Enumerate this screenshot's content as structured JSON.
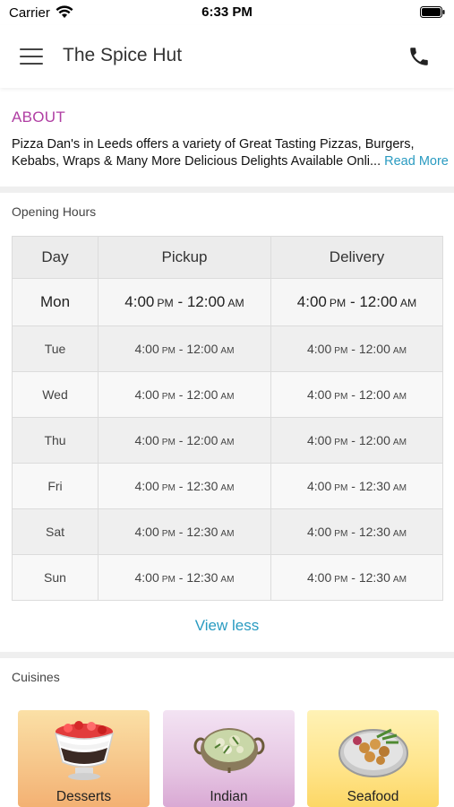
{
  "status_bar": {
    "carrier": "Carrier",
    "time": "6:33 PM"
  },
  "header": {
    "title": "The Spice Hut"
  },
  "about": {
    "heading": "ABOUT",
    "text_line1": "Pizza Dan's in Leeds offers a variety of Great Tasting Pizzas, Burgers,",
    "text_line2": "Kebabs, Wraps & Many More Delicious Delights Available Onli...",
    "read_more": "Read More"
  },
  "opening_hours": {
    "heading": "Opening Hours",
    "columns": [
      "Day",
      "Pickup",
      "Delivery"
    ],
    "rows": [
      {
        "day": "Mon",
        "pickup_from": "4:00",
        "pickup_from_ampm": "PM",
        "pickup_to": "12:00",
        "pickup_to_ampm": "AM",
        "delivery_from": "4:00",
        "delivery_from_ampm": "PM",
        "delivery_to": "12:00",
        "delivery_to_ampm": "AM"
      },
      {
        "day": "Tue",
        "pickup_from": "4:00",
        "pickup_from_ampm": "PM",
        "pickup_to": "12:00",
        "pickup_to_ampm": "AM",
        "delivery_from": "4:00",
        "delivery_from_ampm": "PM",
        "delivery_to": "12:00",
        "delivery_to_ampm": "AM"
      },
      {
        "day": "Wed",
        "pickup_from": "4:00",
        "pickup_from_ampm": "PM",
        "pickup_to": "12:00",
        "pickup_to_ampm": "AM",
        "delivery_from": "4:00",
        "delivery_from_ampm": "PM",
        "delivery_to": "12:00",
        "delivery_to_ampm": "AM"
      },
      {
        "day": "Thu",
        "pickup_from": "4:00",
        "pickup_from_ampm": "PM",
        "pickup_to": "12:00",
        "pickup_to_ampm": "AM",
        "delivery_from": "4:00",
        "delivery_from_ampm": "PM",
        "delivery_to": "12:00",
        "delivery_to_ampm": "AM"
      },
      {
        "day": "Fri",
        "pickup_from": "4:00",
        "pickup_from_ampm": "PM",
        "pickup_to": "12:30",
        "pickup_to_ampm": "AM",
        "delivery_from": "4:00",
        "delivery_from_ampm": "PM",
        "delivery_to": "12:30",
        "delivery_to_ampm": "AM"
      },
      {
        "day": "Sat",
        "pickup_from": "4:00",
        "pickup_from_ampm": "PM",
        "pickup_to": "12:30",
        "pickup_to_ampm": "AM",
        "delivery_from": "4:00",
        "delivery_from_ampm": "PM",
        "delivery_to": "12:30",
        "delivery_to_ampm": "AM"
      },
      {
        "day": "Sun",
        "pickup_from": "4:00",
        "pickup_from_ampm": "PM",
        "pickup_to": "12:30",
        "pickup_to_ampm": "AM",
        "delivery_from": "4:00",
        "delivery_from_ampm": "PM",
        "delivery_to": "12:30",
        "delivery_to_ampm": "AM"
      }
    ],
    "view_less": "View less"
  },
  "cuisines": {
    "heading": "Cuisines",
    "items": [
      {
        "label": "Desserts",
        "icon": "dessert-bowl-icon"
      },
      {
        "label": "Indian",
        "icon": "curry-kadai-icon"
      },
      {
        "label": "Seafood",
        "icon": "seafood-platter-icon"
      }
    ]
  },
  "colors": {
    "about_heading": "#b03fa3",
    "link": "#2a9bc1"
  }
}
